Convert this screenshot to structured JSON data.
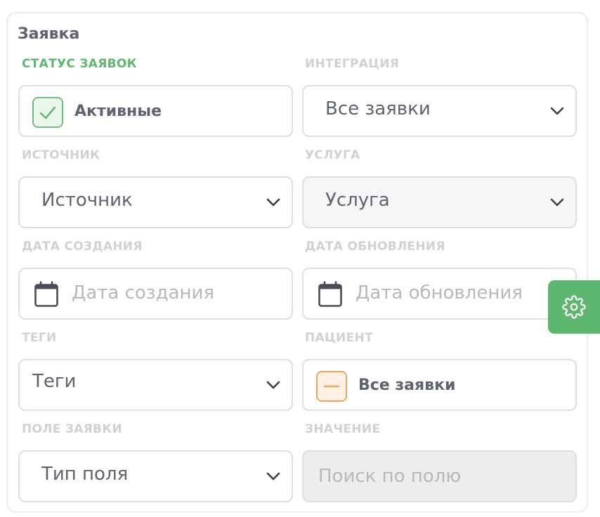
{
  "panel": {
    "title": "Заявка"
  },
  "fields": {
    "status": {
      "label": "СТАТУС ЗАЯВОК",
      "value": "Активные",
      "checked": true
    },
    "integration": {
      "label": "ИНТЕГРАЦИЯ",
      "value": "Все заявки"
    },
    "source": {
      "label": "ИСТОЧНИК",
      "value": "Источник"
    },
    "service": {
      "label": "УСЛУГА",
      "value": "Услуга"
    },
    "created": {
      "label": "ДАТА СОЗДАНИЯ",
      "placeholder": "Дата создания"
    },
    "updated": {
      "label": "ДАТА ОБНОВЛЕНИЯ",
      "placeholder": "Дата обновления"
    },
    "tags": {
      "label": "ТЕГИ",
      "value": "Теги"
    },
    "patient": {
      "label": "ПАЦИЕНТ",
      "value": "Все заявки",
      "state": "indeterminate"
    },
    "field": {
      "label": "ПОЛЕ ЗАЯВКИ",
      "value": "Тип поля"
    },
    "search": {
      "label": "ЗНАЧЕНИЕ",
      "placeholder": "Поиск по полю"
    }
  },
  "icons": {
    "check": "check-icon",
    "minus": "minus-icon",
    "calendar": "calendar-icon",
    "chevron": "chevron-down-icon",
    "gear": "gear-icon"
  },
  "colors": {
    "accent_green": "#5eb76e",
    "indeterminate_orange": "#f2a55c",
    "text": "#5f6270",
    "muted": "#d0d1d6"
  }
}
